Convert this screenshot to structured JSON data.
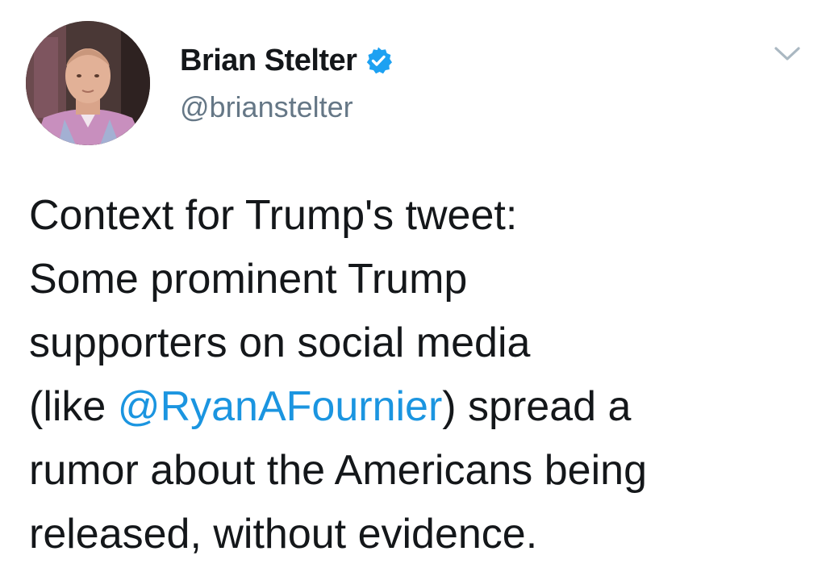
{
  "author": {
    "display_name": "Brian Stelter",
    "handle": "@brianstelter",
    "verified": true,
    "avatar_icon": "profile-photo"
  },
  "tweet": {
    "lines": [
      {
        "parts": [
          {
            "text": "Context for Trump's tweet:",
            "mention": false
          }
        ]
      },
      {
        "parts": [
          {
            "text": "Some prominent Trump",
            "mention": false
          }
        ]
      },
      {
        "parts": [
          {
            "text": "supporters on social media",
            "mention": false
          }
        ]
      },
      {
        "parts": [
          {
            "text": "(like ",
            "mention": false
          },
          {
            "text": "@RyanAFournier",
            "mention": true
          },
          {
            "text": ") spread a",
            "mention": false
          }
        ]
      },
      {
        "parts": [
          {
            "text": "rumor about the Americans being",
            "mention": false
          }
        ]
      },
      {
        "parts": [
          {
            "text": "released, without evidence.",
            "mention": false
          }
        ]
      }
    ]
  },
  "menu_icon": "chevron-down-icon",
  "colors": {
    "text": "#14171a",
    "secondary": "#657786",
    "link": "#1b95e0",
    "verified": "#1da1f2",
    "chevron": "#aab8c2"
  }
}
